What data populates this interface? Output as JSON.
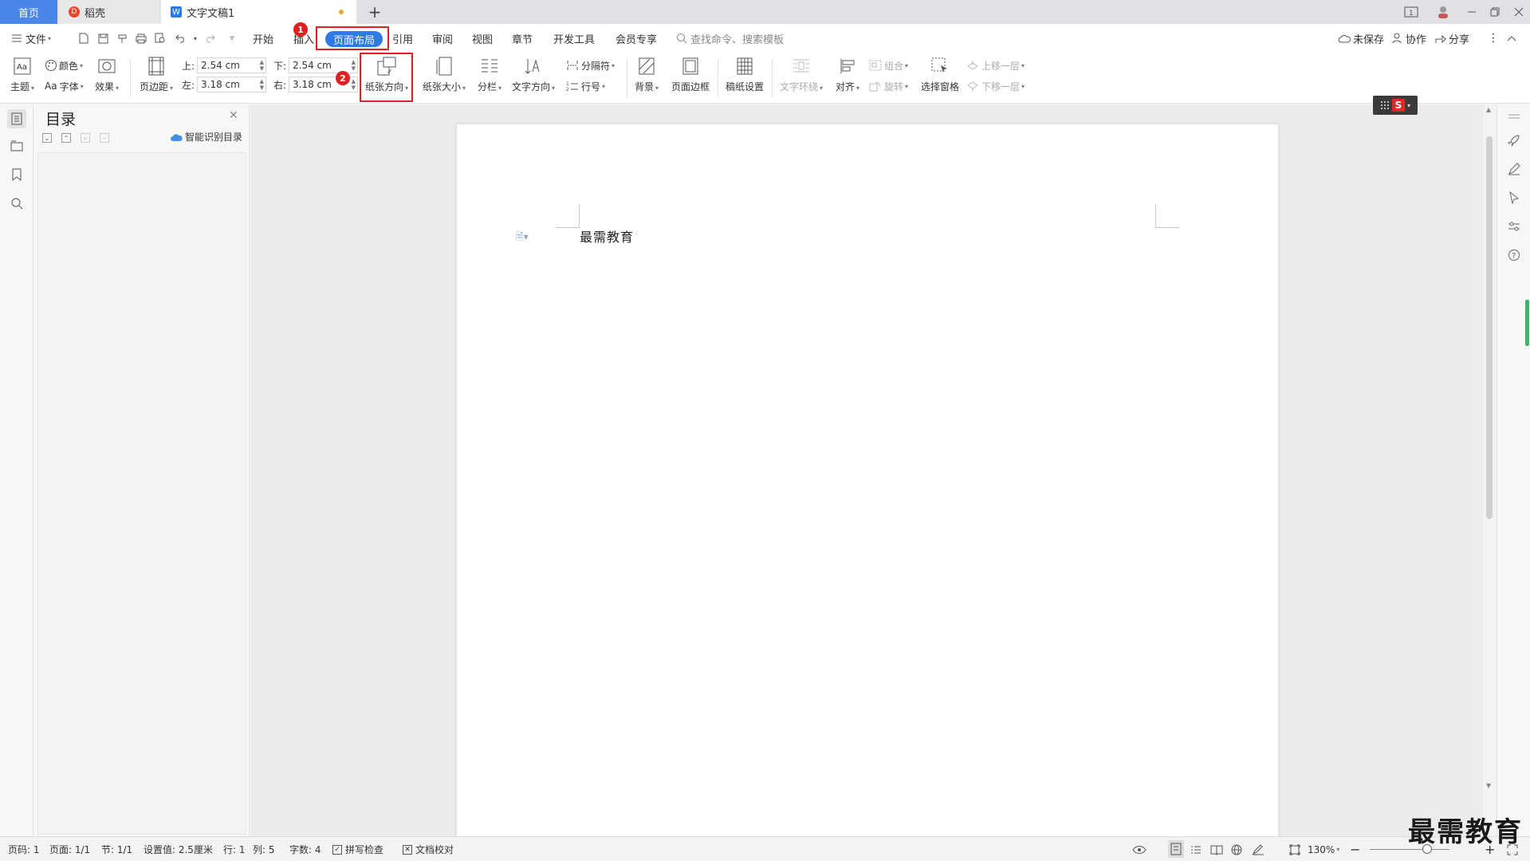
{
  "tabs": {
    "home": "首页",
    "daoke": "稻壳",
    "doc": "文字文稿1",
    "plus": "+"
  },
  "menu": {
    "file": "文件",
    "start": "开始",
    "insert": "插入",
    "page_layout": "页面布局",
    "references": "引用",
    "review": "审阅",
    "view": "视图",
    "sections": "章节",
    "developer": "开发工具",
    "member": "会员专享",
    "search_placeholder": "查找命令、搜索模板",
    "unsaved": "未保存",
    "collaborate": "协作",
    "share": "分享"
  },
  "ribbon": {
    "theme": "主题",
    "color": "颜色",
    "font": "字体",
    "font_prefix": "Aa",
    "effects": "效果",
    "margins": "页边距",
    "top_label": "上:",
    "top_value": "2.54 cm",
    "bottom_label": "下:",
    "bottom_value": "2.54 cm",
    "left_label": "左:",
    "left_value": "3.18 cm",
    "right_label": "右:",
    "right_value": "3.18 cm",
    "orientation": "纸张方向",
    "size": "纸张大小",
    "columns": "分栏",
    "text_direction": "文字方向",
    "breaks": "分隔符",
    "line_numbers": "行号",
    "background": "背景",
    "page_border": "页面边框",
    "manuscript": "稿纸设置",
    "text_wrap": "文字环绕",
    "align": "对齐",
    "group": "组合",
    "rotate": "旋转",
    "selection_pane": "选择窗格",
    "bring_forward": "上移一层",
    "send_backward": "下移一层"
  },
  "annotations": {
    "step1": "1",
    "step2": "2"
  },
  "toc": {
    "title": "目录",
    "smart": "智能识别目录"
  },
  "document": {
    "text": "最需教育"
  },
  "status": {
    "page_no": "页码: 1",
    "pages": "页面: 1/1",
    "section": "节: 1/1",
    "setting": "设置值: 2.5厘米",
    "row": "行: 1",
    "col": "列: 5",
    "words": "字数: 4",
    "spell": "拼写检查",
    "proof": "文档校对",
    "zoom": "130%"
  },
  "watermark": "最需教育",
  "colors": {
    "accent": "#2f7be6",
    "annotation": "#e02020",
    "home_tab": "#4a86e8"
  }
}
